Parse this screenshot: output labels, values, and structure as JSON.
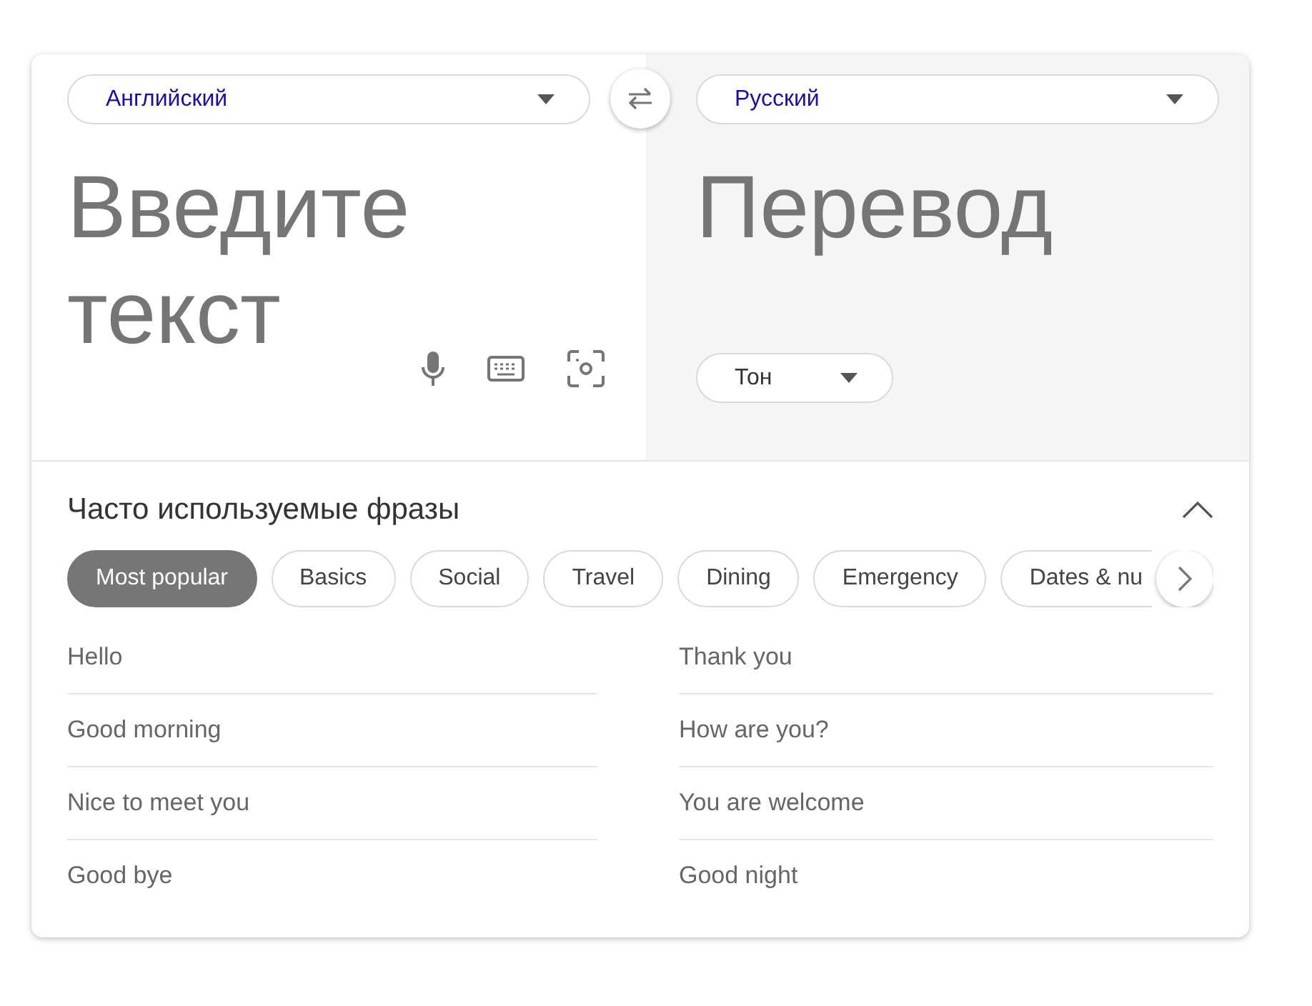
{
  "source": {
    "language": "Английский",
    "placeholder": "Введите текст"
  },
  "target": {
    "language": "Русский",
    "placeholder": "Перевод",
    "tone": "Тон"
  },
  "phrases": {
    "title": "Часто используемые фразы",
    "expanded": true,
    "categories": [
      {
        "label": "Most popular",
        "selected": true
      },
      {
        "label": "Basics",
        "selected": false
      },
      {
        "label": "Social",
        "selected": false
      },
      {
        "label": "Travel",
        "selected": false
      },
      {
        "label": "Dining",
        "selected": false
      },
      {
        "label": "Emergency",
        "selected": false
      },
      {
        "label": "Dates & nu",
        "selected": false
      }
    ],
    "items": [
      "Hello",
      "Thank you",
      "Good morning",
      "How are you?",
      "Nice to meet you",
      "You are welcome",
      "Good bye",
      "Good night"
    ]
  }
}
